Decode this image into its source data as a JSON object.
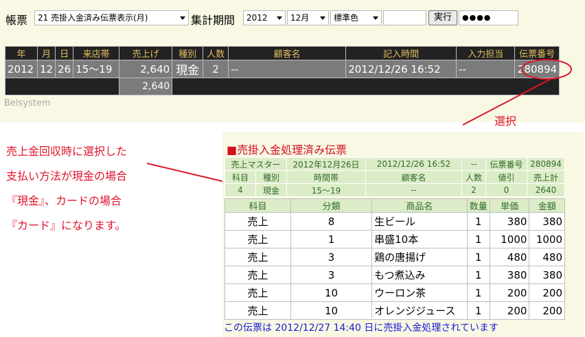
{
  "toolbar": {
    "label_form": "帳票",
    "form_select": "21 売掛入金済み伝票表示(月)",
    "label_period": "集計期間",
    "year_select": "2012",
    "month_select": "12月",
    "color_select": "標準色",
    "blank_input": "",
    "run_label": "実行",
    "password_mask": "●●●●"
  },
  "main_table": {
    "headers": [
      "年",
      "月",
      "日",
      "来店帯",
      "売上げ",
      "種別",
      "人数",
      "顧客名",
      "記入時間",
      "入力担当",
      "伝票番号"
    ],
    "row": [
      "2012",
      "12",
      "26",
      "15～19",
      "2,640",
      "現金",
      "2",
      "--",
      "2012/12/26 16:52",
      "--",
      "280894"
    ],
    "total": "2,640"
  },
  "brand": "Belsystem",
  "annotations": {
    "select_label": "選択",
    "note_lines": [
      "売上金回収時に選択した",
      "支払い方法が現金の場合",
      "『現金』、カードの場合",
      "『カード』になります。"
    ]
  },
  "slip": {
    "title": "■売掛入金処理済み伝票",
    "head_row1": [
      "売上マスター",
      "2012年12月26日",
      "2012/12/26 16:52",
      "--",
      "伝票番号",
      "280894"
    ],
    "head_row2": [
      "科目",
      "種別",
      "時間帯",
      "顧客名",
      "人数",
      "値引",
      "売上計"
    ],
    "head_row3": [
      "4",
      "現金",
      "15～19",
      "--",
      "2",
      "0",
      "2640"
    ],
    "item_headers": [
      "科目",
      "分類",
      "商品名",
      "数量",
      "単価",
      "金額"
    ],
    "items": [
      [
        "売上",
        "8",
        "生ビール",
        "1",
        "380",
        "380"
      ],
      [
        "売上",
        "1",
        "串盛10本",
        "1",
        "1000",
        "1000"
      ],
      [
        "売上",
        "3",
        "鶏の唐揚げ",
        "1",
        "480",
        "480"
      ],
      [
        "売上",
        "3",
        "もつ煮込み",
        "1",
        "380",
        "380"
      ],
      [
        "売上",
        "10",
        "ウーロン茶",
        "1",
        "200",
        "200"
      ],
      [
        "売上",
        "10",
        "オレンジジュース",
        "1",
        "200",
        "200"
      ]
    ],
    "footnote": "この伝票は 2012/12/27 14:40 日に売掛入金処理されています"
  },
  "colors": {
    "annotation_red": "#e0142a",
    "table_header_gold": "#e2bf62",
    "slip_green": "#2f6b27",
    "footnote_blue": "#1a1ad4"
  }
}
